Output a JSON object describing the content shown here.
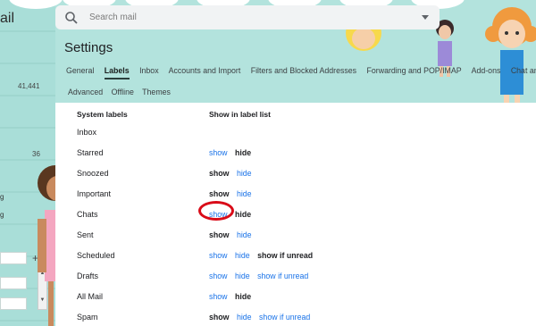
{
  "app": {
    "title_fragment": "ail"
  },
  "search": {
    "placeholder": "Search mail"
  },
  "left_sidebar": {
    "count_1": "41,441",
    "count_2": "36",
    "frag_1": "g",
    "frag_2": "g"
  },
  "settings": {
    "title": "Settings",
    "tabs": [
      {
        "label": "General"
      },
      {
        "label": "Labels",
        "active": true
      },
      {
        "label": "Inbox"
      },
      {
        "label": "Accounts and Import"
      },
      {
        "label": "Filters and Blocked Addresses"
      },
      {
        "label": "Forwarding and POP/IMAP"
      },
      {
        "label": "Add-ons"
      },
      {
        "label": "Chat and"
      }
    ],
    "tabs_row2": [
      {
        "label": "Advanced"
      },
      {
        "label": "Offline"
      },
      {
        "label": "Themes"
      }
    ]
  },
  "labels_table": {
    "col_system": "System labels",
    "col_show": "Show in label list",
    "rows": [
      {
        "name": "Inbox",
        "options": []
      },
      {
        "name": "Starred",
        "options": [
          {
            "text": "show",
            "style": "link"
          },
          {
            "text": "hide",
            "style": "bold"
          }
        ]
      },
      {
        "name": "Snoozed",
        "options": [
          {
            "text": "show",
            "style": "bold"
          },
          {
            "text": "hide",
            "style": "link"
          }
        ]
      },
      {
        "name": "Important",
        "options": [
          {
            "text": "show",
            "style": "bold"
          },
          {
            "text": "hide",
            "style": "link"
          }
        ]
      },
      {
        "name": "Chats",
        "options": [
          {
            "text": "show",
            "style": "link"
          },
          {
            "text": "hide",
            "style": "bold"
          }
        ]
      },
      {
        "name": "Sent",
        "options": [
          {
            "text": "show",
            "style": "bold"
          },
          {
            "text": "hide",
            "style": "link"
          }
        ]
      },
      {
        "name": "Scheduled",
        "options": [
          {
            "text": "show",
            "style": "link"
          },
          {
            "text": "hide",
            "style": "link"
          },
          {
            "text": "show if unread",
            "style": "bold"
          }
        ]
      },
      {
        "name": "Drafts",
        "options": [
          {
            "text": "show",
            "style": "link"
          },
          {
            "text": "hide",
            "style": "link"
          },
          {
            "text": "show if unread",
            "style": "link"
          }
        ]
      },
      {
        "name": "All Mail",
        "options": [
          {
            "text": "show",
            "style": "link"
          },
          {
            "text": "hide",
            "style": "bold"
          }
        ]
      },
      {
        "name": "Spam",
        "options": [
          {
            "text": "show",
            "style": "bold"
          },
          {
            "text": "hide",
            "style": "link"
          },
          {
            "text": "show if unread",
            "style": "link"
          }
        ]
      }
    ]
  },
  "colors": {
    "accent_link": "#1a73e8",
    "annotation": "#d90b18",
    "theme_bg": "#a9ded8"
  }
}
